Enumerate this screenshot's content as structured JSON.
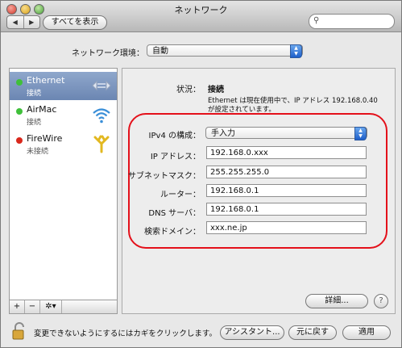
{
  "window": {
    "title": "ネットワーク"
  },
  "toolbar": {
    "back_glyph": "◀",
    "forward_glyph": "▶",
    "show_all_label": "すべてを表示",
    "search_placeholder": ""
  },
  "location": {
    "label": "ネットワーク環境：",
    "value": "自動"
  },
  "services": [
    {
      "name": "Ethernet",
      "status": "接続",
      "dot_color": "#3fc03a",
      "icon": "ethernet-icon",
      "selected": true
    },
    {
      "name": "AirMac",
      "status": "接続",
      "dot_color": "#3fc03a",
      "icon": "wifi-icon",
      "selected": false
    },
    {
      "name": "FireWire",
      "status": "未接続",
      "dot_color": "#d9281c",
      "icon": "firewire-icon",
      "selected": false
    }
  ],
  "sidebar_controls": {
    "add": "+",
    "remove": "−",
    "gear": "✲▾"
  },
  "detail": {
    "status_label": "状況：",
    "status_value": "接続",
    "status_desc": "Ethernet は現在使用中で、IP アドレス 192.168.0.40 が設定されています。",
    "config_label": "IPv4 の構成：",
    "config_value": "手入力",
    "ip_label": "IP アドレス：",
    "ip_value": "192.168.0.xxx",
    "subnet_label": "サブネットマスク：",
    "subnet_value": "255.255.255.0",
    "router_label": "ルーター：",
    "router_value": "192.168.0.1",
    "dns_label": "DNS サーバ：",
    "dns_value": "192.168.0.1",
    "domain_label": "検索ドメイン：",
    "domain_value": "xxx.ne.jp",
    "advanced_label": "詳細...",
    "help_label": "?"
  },
  "footer": {
    "lock_message": "変更できないようにするにはカギをクリックします。",
    "assistant_label": "アシスタント...",
    "revert_label": "元に戻す",
    "apply_label": "適用"
  },
  "colors": {
    "highlight_outline": "#e4101a",
    "selection": "#7890b8",
    "accent": "#1e5fc9"
  }
}
